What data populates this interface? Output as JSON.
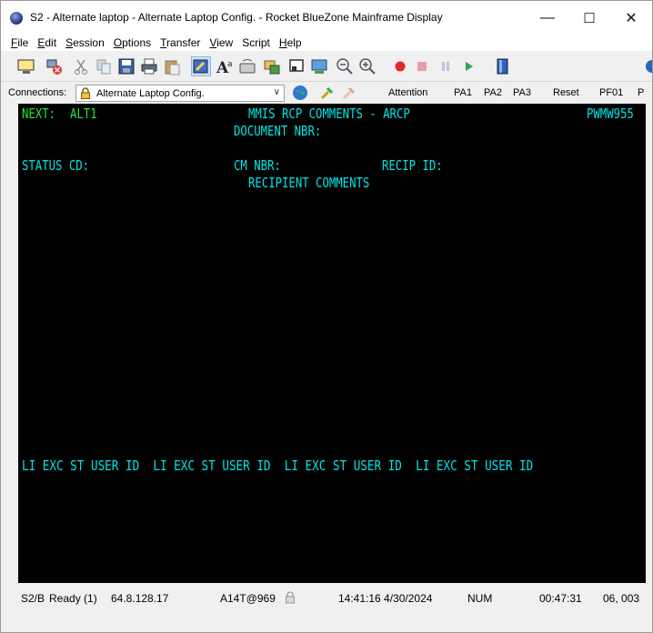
{
  "window": {
    "title": "S2 - Alternate laptop - Alternate Laptop Config. - Rocket BlueZone Mainframe Display",
    "minimize_glyph": "—",
    "maximize_glyph": "☐",
    "close_glyph": "✕"
  },
  "menu": {
    "items": [
      {
        "key": "F",
        "rest": "ile"
      },
      {
        "key": "E",
        "rest": "dit"
      },
      {
        "key": "S",
        "rest": "ession"
      },
      {
        "key": "O",
        "rest": "ptions"
      },
      {
        "key": "T",
        "rest": "ransfer"
      },
      {
        "key": "V",
        "rest": "iew"
      },
      {
        "key": "Sc",
        "rest": "ript"
      },
      {
        "key": "H",
        "rest": "elp"
      }
    ]
  },
  "toolbar": {
    "icons": [
      "new-session-icon",
      "disconnect-icon",
      "cut-icon",
      "copy-icon",
      "save-icon",
      "print-icon",
      "paste-icon",
      "edit-icon",
      "font-icon",
      "keyboard-icon",
      "transfer-icon",
      "screen-icon",
      "display-icon",
      "zoom-out-icon",
      "zoom-in-icon",
      "record-icon",
      "stop-icon",
      "pause-icon",
      "play-icon",
      "script-icon"
    ]
  },
  "connections": {
    "label": "Connections:",
    "selected": "Alternate Laptop Config.",
    "buttons": {
      "attention": "Attention",
      "pa1": "PA1",
      "pa2": "PA2",
      "pa3": "PA3",
      "reset": "Reset",
      "pf01": "PF01",
      "more": "P"
    }
  },
  "terminal": {
    "next_label": "NEXT:",
    "next_value": "ALT1",
    "screen_title": "MMIS RCP COMMENTS - ARCP",
    "screen_id": "PWMW955",
    "document_nbr_label": "DOCUMENT NBR:",
    "status_cd_label": "STATUS CD:",
    "cm_nbr_label": "CM NBR:",
    "recip_id_label": "RECIP ID:",
    "section_title": "RECIPIENT COMMENTS",
    "footer_header": "LI EXC ST USER ID  LI EXC ST USER ID  LI EXC ST USER ID  LI EXC ST USER ID"
  },
  "status": {
    "session": "S2/B",
    "state": "Ready (1)",
    "host": "64.8.128.17",
    "lu": "A14T@969",
    "datetime": "14:41:16 4/30/2024",
    "num": "NUM",
    "elapsed": "00:47:31",
    "cursor": "06, 003"
  }
}
